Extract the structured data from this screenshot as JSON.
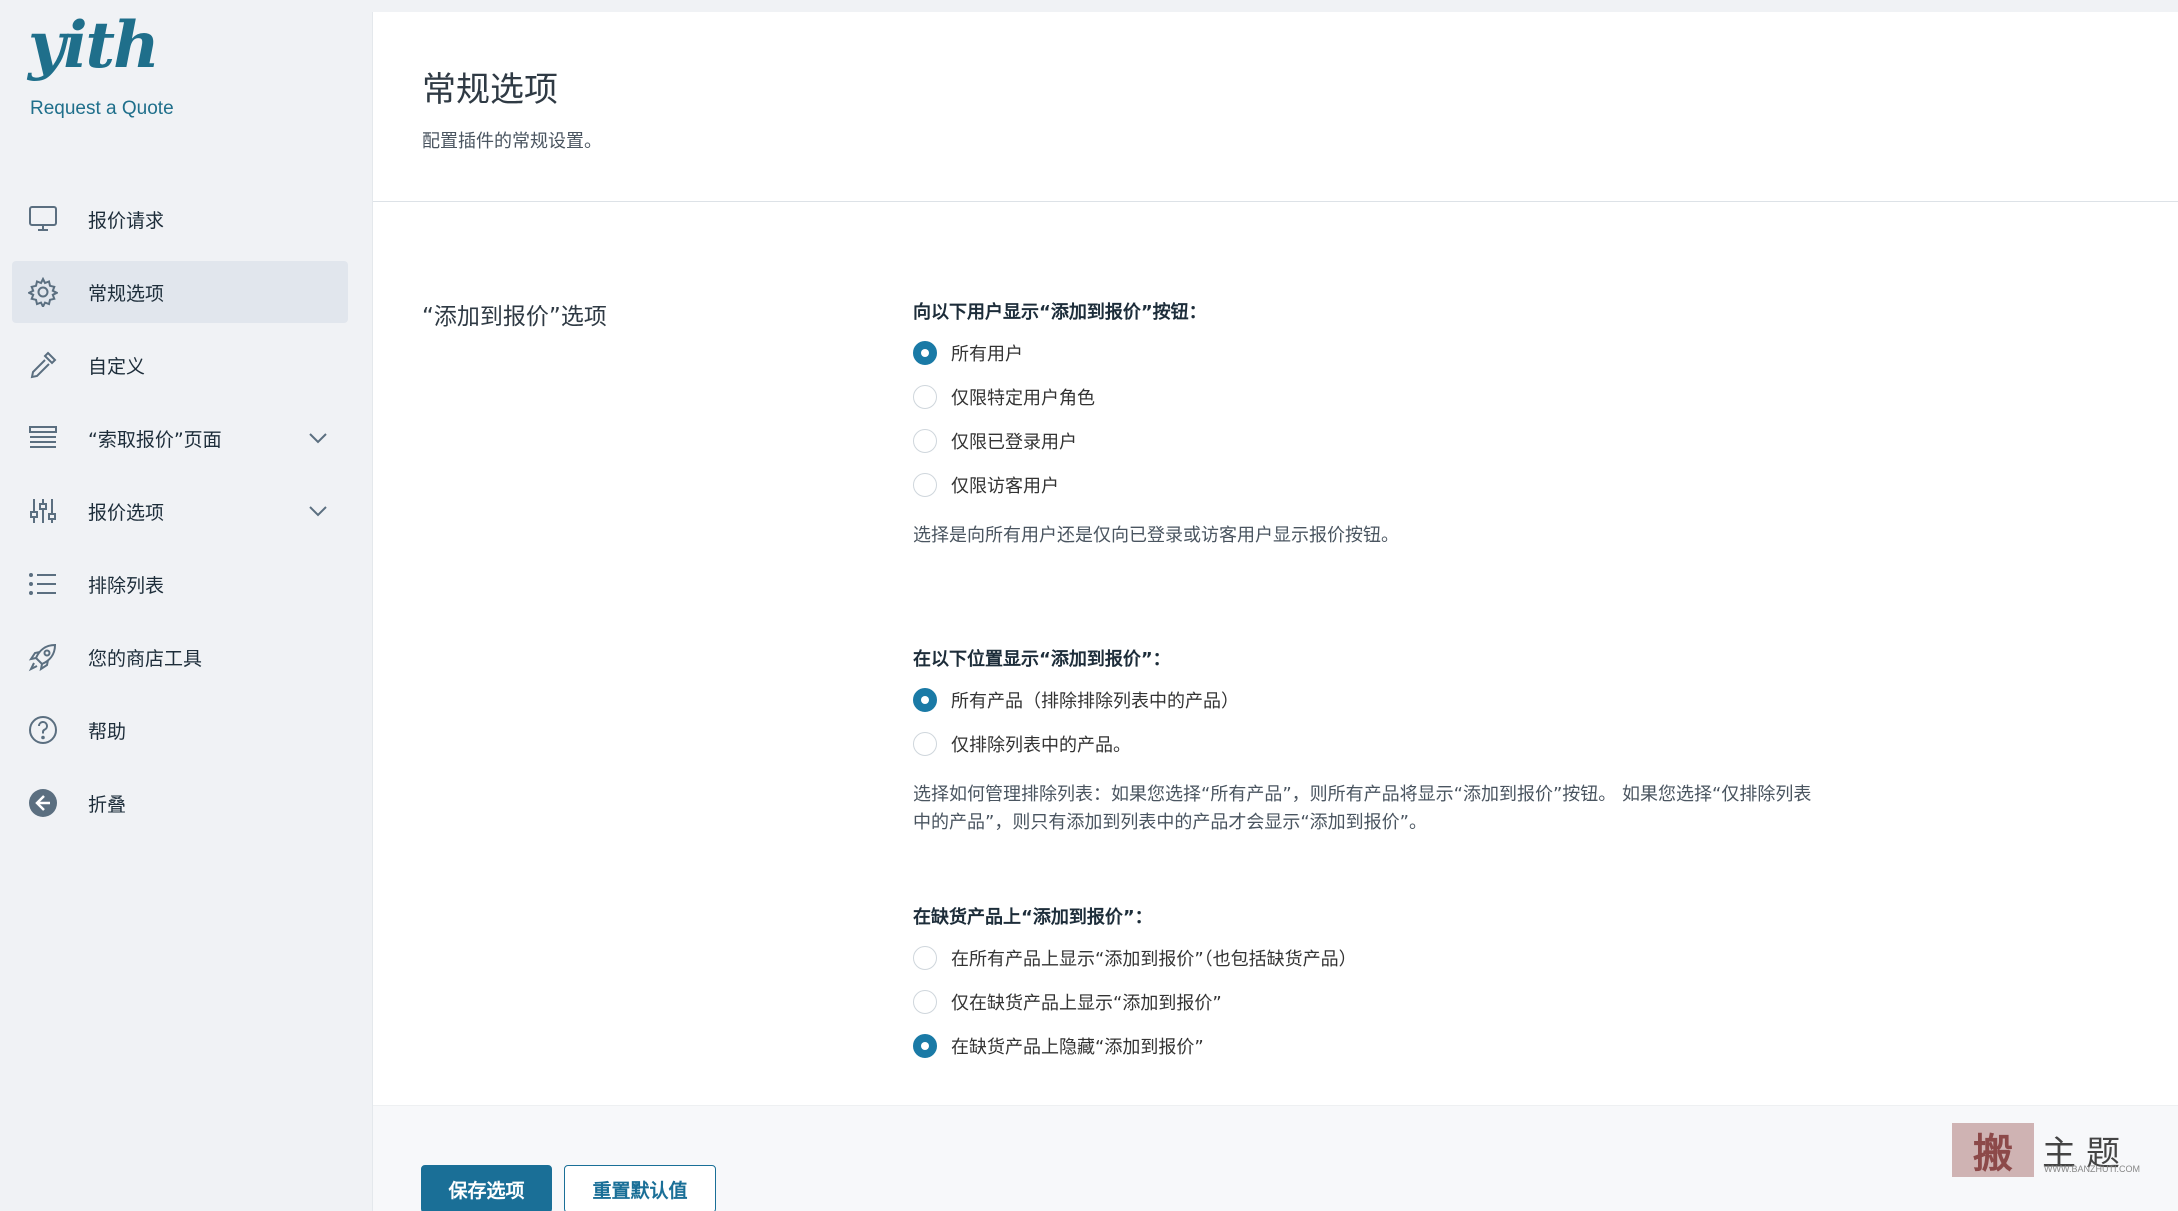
{
  "brand": {
    "logo_text": "yith",
    "subtitle": "Request a Quote"
  },
  "sidebar": {
    "items": [
      {
        "label": "报价请求",
        "icon": "monitor-icon",
        "active": false,
        "expandable": false
      },
      {
        "label": "常规选项",
        "icon": "gear-icon",
        "active": true,
        "expandable": false
      },
      {
        "label": "自定义",
        "icon": "eyedropper-icon",
        "active": false,
        "expandable": false
      },
      {
        "label": "“索取报价”页面",
        "icon": "layers-icon",
        "active": false,
        "expandable": true
      },
      {
        "label": "报价选项",
        "icon": "sliders-icon",
        "active": false,
        "expandable": true
      },
      {
        "label": "排除列表",
        "icon": "list-icon",
        "active": false,
        "expandable": false
      },
      {
        "label": "您的商店工具",
        "icon": "rocket-icon",
        "active": false,
        "expandable": false
      },
      {
        "label": "帮助",
        "icon": "help-icon",
        "active": false,
        "expandable": false
      },
      {
        "label": "折叠",
        "icon": "collapse-arrow-icon",
        "active": false,
        "expandable": false
      }
    ]
  },
  "page": {
    "title": "常规选项",
    "description": "配置插件的常规设置。"
  },
  "section": {
    "title": "“添加到报价”选项"
  },
  "fields": [
    {
      "label": "向以下用户显示“添加到报价”按钮：",
      "options": [
        "所有用户",
        "仅限特定用户角色",
        "仅限已登录用户",
        "仅限访客用户"
      ],
      "selected": 0,
      "help": "选择是向所有用户还是仅向已登录或访客用户显示报价按钮。"
    },
    {
      "label": "在以下位置显示“添加到报价”：",
      "options": [
        "所有产品（排除排除列表中的产品）",
        "仅排除列表中的产品。"
      ],
      "selected": 0,
      "help": "选择如何管理排除列表：如果您选择“所有产品”，则所有产品将显示“添加到报价”按钮。 如果您选择“仅排除列表中的产品”，则只有添加到列表中的产品才会显示“添加到报价”。"
    },
    {
      "label": "在缺货产品上“添加到报价”：",
      "options": [
        "在所有产品上显示“添加到报价”（也包括缺货产品）",
        "仅在缺货产品上显示“添加到报价”",
        "在缺货产品上隐藏“添加到报价”"
      ],
      "selected": 2
    }
  ],
  "footer": {
    "save_label": "保存选项",
    "reset_label": "重置默认值"
  },
  "watermark": {
    "box_text": "搬",
    "text": "主题",
    "sub": "WWW.BANZHUTI.COM"
  },
  "colors": {
    "accent": "#1a6f97",
    "radio_checked": "#1a7aa6",
    "brand": "#1f6f8b"
  }
}
